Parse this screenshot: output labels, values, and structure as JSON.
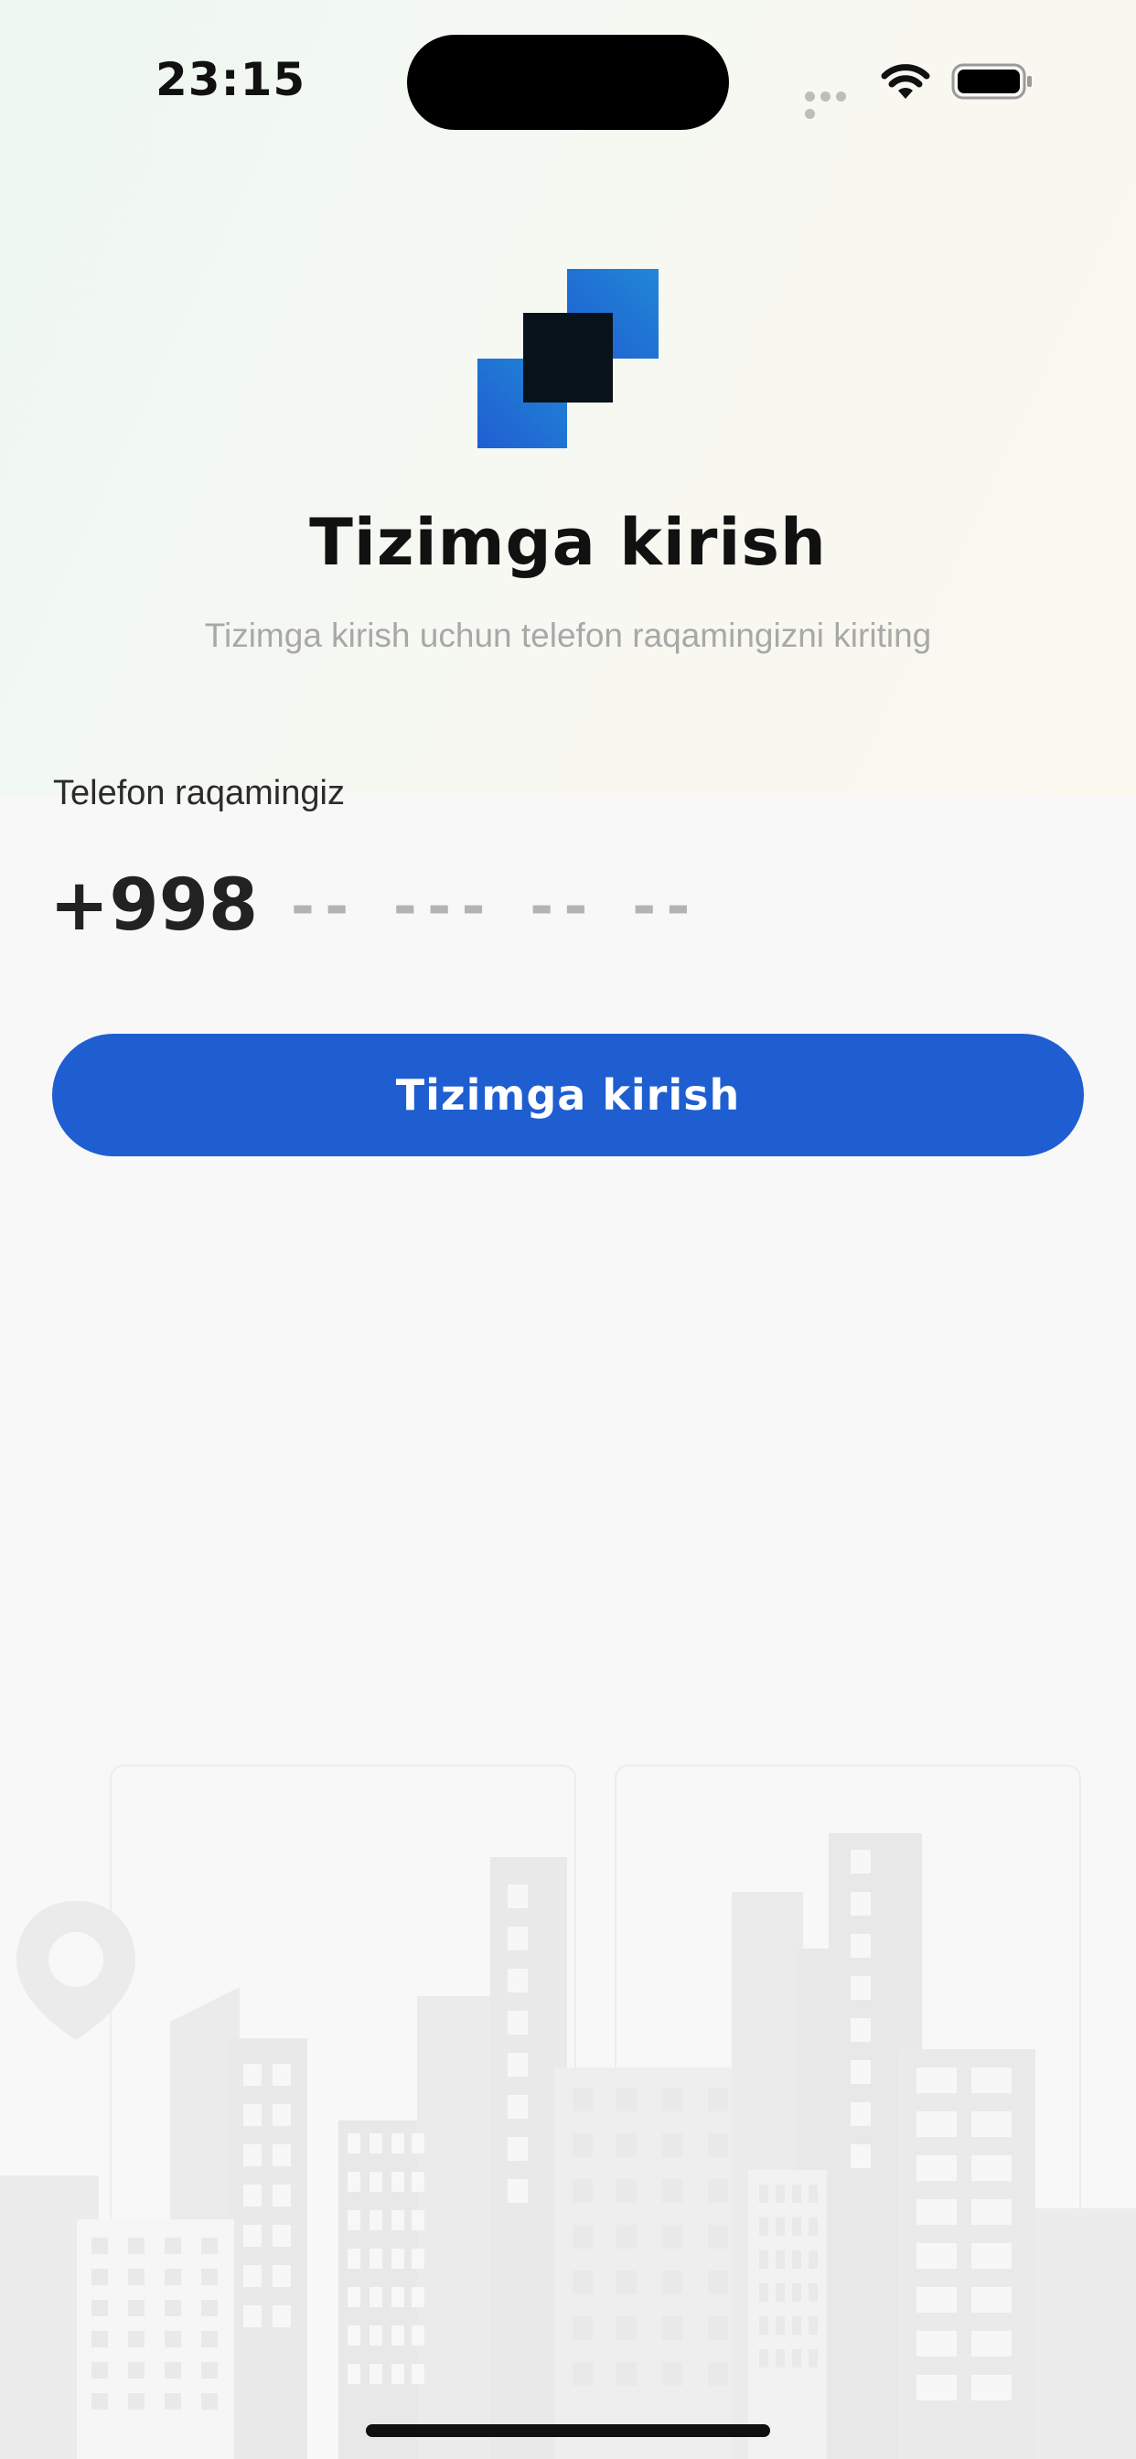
{
  "status_bar": {
    "time": "23:15"
  },
  "header": {
    "title": "Tizimga kirish",
    "subtitle": "Tizimga kirish uchun telefon raqamingizni kiriting"
  },
  "phone_form": {
    "label": "Telefon raqamingiz",
    "country_code": "+998",
    "placeholder": "-- --- -- --",
    "value": ""
  },
  "login_button": {
    "label": "Tizimga kirish"
  },
  "icons": {
    "logo": "app-logo-icon",
    "signal": "cellular-signal-icon",
    "wifi": "wifi-icon",
    "battery": "battery-icon",
    "location": "location-pin-icon"
  },
  "colors": {
    "primary": "#1f5ed1",
    "logo_blue_start": "#1f5ed1",
    "logo_blue_end": "#2187d6",
    "logo_dark": "#07121a",
    "text_dark": "#111111",
    "text_muted": "#a8a8a8",
    "background": "#f8f8f8"
  }
}
